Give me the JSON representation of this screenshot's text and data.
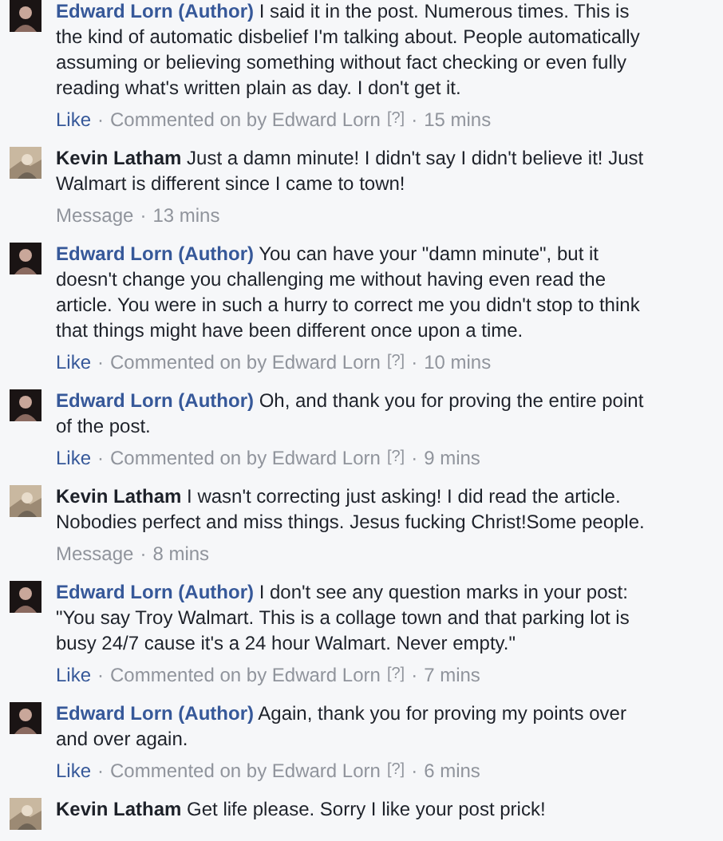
{
  "comments": [
    {
      "author": "Edward Lorn (Author)",
      "kind": "page",
      "text": "I said it in the post. Numerous times. This is the kind of automatic disbelief I'm talking about. People automatically assuming or believing something without fact checking or even fully reading what's written plain as day. I don't get it.",
      "meta": [
        {
          "kind": "link",
          "text": "Like"
        },
        {
          "kind": "sep",
          "text": "·"
        },
        {
          "kind": "text",
          "text": "Commented on by Edward Lorn"
        },
        {
          "kind": "help",
          "text": "[?]"
        },
        {
          "kind": "sep",
          "text": "·"
        },
        {
          "kind": "time",
          "text": "15 mins"
        }
      ]
    },
    {
      "author": "Kevin Latham",
      "kind": "user",
      "text": "Just a damn minute! I didn't say I didn't believe it! Just Walmart is different since I came to town!",
      "meta": [
        {
          "kind": "action",
          "text": "Message"
        },
        {
          "kind": "sep",
          "text": "·"
        },
        {
          "kind": "time",
          "text": "13 mins"
        }
      ]
    },
    {
      "author": "Edward Lorn (Author)",
      "kind": "page",
      "text": "You can have your \"damn minute\", but it doesn't change you challenging me without having even read the article. You were in such a hurry to correct me you didn't stop to think that things might have been different once upon a time.",
      "meta": [
        {
          "kind": "link",
          "text": "Like"
        },
        {
          "kind": "sep",
          "text": "·"
        },
        {
          "kind": "text",
          "text": "Commented on by Edward Lorn"
        },
        {
          "kind": "help",
          "text": "[?]"
        },
        {
          "kind": "sep",
          "text": "·"
        },
        {
          "kind": "time",
          "text": "10 mins"
        }
      ]
    },
    {
      "author": "Edward Lorn (Author)",
      "kind": "page",
      "text": "Oh, and thank you for proving the entire point of the post.",
      "meta": [
        {
          "kind": "link",
          "text": "Like"
        },
        {
          "kind": "sep",
          "text": "·"
        },
        {
          "kind": "text",
          "text": "Commented on by Edward Lorn"
        },
        {
          "kind": "help",
          "text": "[?]"
        },
        {
          "kind": "sep",
          "text": "·"
        },
        {
          "kind": "time",
          "text": "9 mins"
        }
      ]
    },
    {
      "author": "Kevin Latham",
      "kind": "user",
      "text": "I wasn't correcting just asking! I did read the article. Nobodies perfect and miss things. Jesus fucking Christ!Some people.",
      "meta": [
        {
          "kind": "action",
          "text": "Message"
        },
        {
          "kind": "sep",
          "text": "·"
        },
        {
          "kind": "time",
          "text": "8 mins"
        }
      ]
    },
    {
      "author": "Edward Lorn (Author)",
      "kind": "page",
      "text": "I don't see any question marks in your post: \"You say Troy Walmart. This is a collage town and that parking lot is busy 24/7 cause it's a 24 hour Walmart. Never empty.\"",
      "meta": [
        {
          "kind": "link",
          "text": "Like"
        },
        {
          "kind": "sep",
          "text": "·"
        },
        {
          "kind": "text",
          "text": "Commented on by Edward Lorn"
        },
        {
          "kind": "help",
          "text": "[?]"
        },
        {
          "kind": "sep",
          "text": "·"
        },
        {
          "kind": "time",
          "text": "7 mins"
        }
      ]
    },
    {
      "author": "Edward Lorn (Author)",
      "kind": "page",
      "text": "Again, thank you for proving my points over and over again.",
      "meta": [
        {
          "kind": "link",
          "text": "Like"
        },
        {
          "kind": "sep",
          "text": "·"
        },
        {
          "kind": "text",
          "text": "Commented on by Edward Lorn"
        },
        {
          "kind": "help",
          "text": "[?]"
        },
        {
          "kind": "sep",
          "text": "·"
        },
        {
          "kind": "time",
          "text": "6 mins"
        }
      ]
    },
    {
      "author": "Kevin Latham",
      "kind": "user",
      "text": "Get life please. Sorry I like your post prick!"
    }
  ]
}
